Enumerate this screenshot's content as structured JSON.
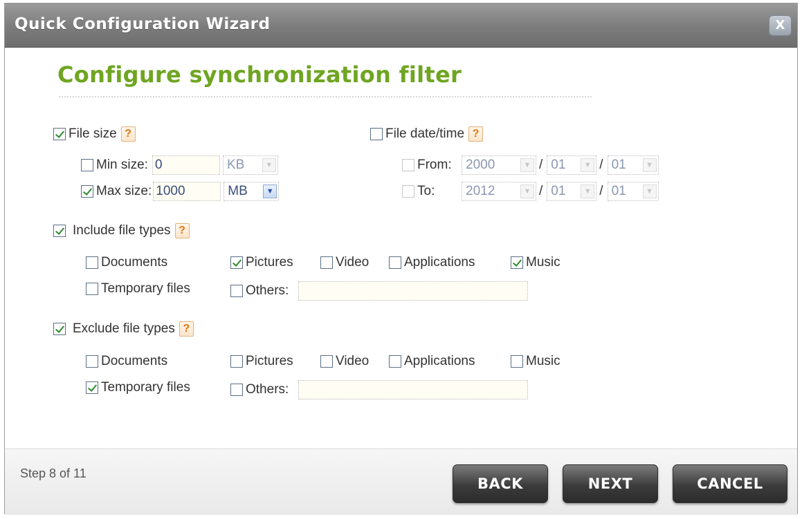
{
  "window": {
    "title": "Quick Configuration Wizard",
    "close_label": "X"
  },
  "heading": "Configure synchronization filter",
  "help_glyph": "?",
  "file_size": {
    "label": "File size",
    "checked": true,
    "min": {
      "label": "Min size:",
      "value": "0",
      "unit": "KB",
      "checked": false
    },
    "max": {
      "label": "Max size:",
      "value": "1000",
      "unit": "MB",
      "checked": true
    }
  },
  "file_datetime": {
    "label": "File date/time",
    "checked": false,
    "from": {
      "label": "From:",
      "year": "2000",
      "month": "01",
      "day": "01"
    },
    "to": {
      "label": "To:",
      "year": "2012",
      "month": "01",
      "day": "01"
    },
    "separator": "/"
  },
  "include": {
    "label": "Include file types",
    "checked": true,
    "documents": "Documents",
    "pictures": "Pictures",
    "video": "Video",
    "applications": "Applications",
    "music": "Music",
    "temporary": "Temporary files",
    "others": "Others:",
    "others_value": ""
  },
  "exclude": {
    "label": "Exclude file types",
    "checked": true,
    "documents": "Documents",
    "pictures": "Pictures",
    "video": "Video",
    "applications": "Applications",
    "music": "Music",
    "temporary": "Temporary files",
    "others": "Others:",
    "others_value": ""
  },
  "footer": {
    "step": "Step 8 of 11",
    "back": "BACK",
    "next": "NEXT",
    "cancel": "CANCEL"
  },
  "colors": {
    "heading_green": "#6fa522",
    "help_orange": "#e0780c",
    "title_bar": "#7c7c7c"
  }
}
